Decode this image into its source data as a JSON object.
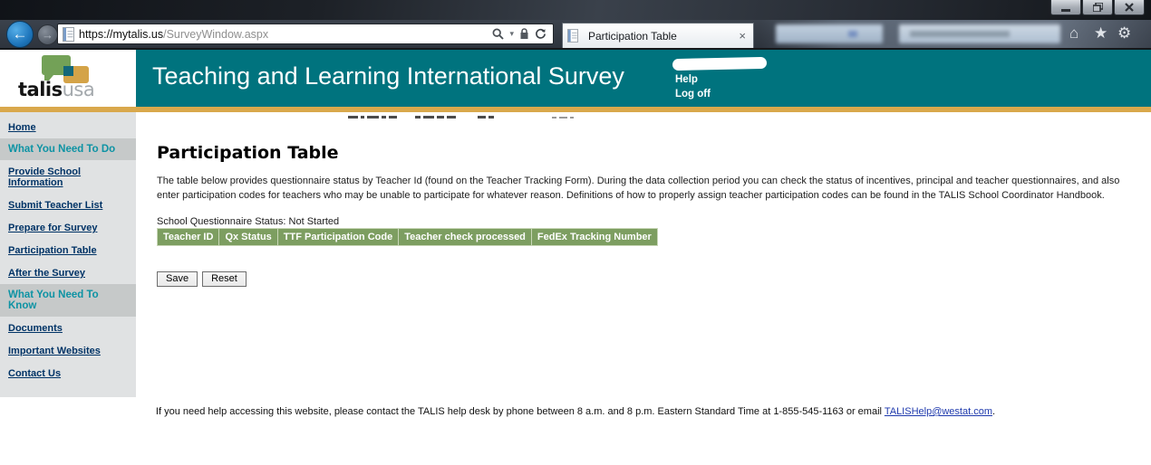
{
  "browser": {
    "url": {
      "host": "https://mytalis.us",
      "path": "/SurveyWindow.aspx"
    },
    "tab_title": "Participation Table",
    "tab_close": "×",
    "back_glyph": "←",
    "forward_glyph": "→",
    "caret_glyph": "▾",
    "home_glyph": "⌂",
    "star_glyph": "★",
    "gear_glyph": "⚙"
  },
  "header": {
    "logo_bold": "talis",
    "logo_light": "usa",
    "title": "Teaching and Learning International Survey",
    "help_label": "Help",
    "logoff_label": "Log off"
  },
  "sidebar": {
    "items": [
      {
        "label": "Home",
        "type": "link"
      },
      {
        "label": "What You Need To Do",
        "type": "section"
      },
      {
        "label": "Provide School Information",
        "type": "link"
      },
      {
        "label": "Submit Teacher List",
        "type": "link"
      },
      {
        "label": "Prepare for Survey",
        "type": "link"
      },
      {
        "label": "Participation Table",
        "type": "link"
      },
      {
        "label": "After the Survey",
        "type": "link"
      },
      {
        "label": "What You Need To Know",
        "type": "section"
      },
      {
        "label": "Documents",
        "type": "link"
      },
      {
        "label": "Important Websites",
        "type": "link"
      },
      {
        "label": "Contact Us",
        "type": "link"
      }
    ]
  },
  "main": {
    "title": "Participation Table",
    "description": "The table below provides questionnaire status by Teacher Id (found on the Teacher Tracking Form). During the data collection period you can check the status of incentives, principal and teacher questionnaires, and also enter participation codes for teachers who may be unable to participate for whatever reason. Definitions of how to properly assign teacher participation codes can be found in the TALIS School Coordinator Handbook.",
    "status_line": "School Questionnaire Status: Not Started",
    "table": {
      "columns": [
        "Teacher ID",
        "Qx Status",
        "TTF Participation Code",
        "Teacher check processed",
        "FedEx Tracking Number"
      ],
      "rows": []
    },
    "save_label": "Save",
    "reset_label": "Reset"
  },
  "footer": {
    "text": "If you need help accessing this website, please contact the TALIS help desk by phone between 8 a.m. and 8 p.m. Eastern Standard Time at 1-855-545-1163 or email ",
    "link": "TALISHelp@westat.com",
    "suffix": "."
  },
  "colors": {
    "header_teal": "#00737e",
    "gold_bar": "#d9a84c",
    "table_header_green": "#7d9e61",
    "sidebar_link_navy": "#003366",
    "sidebar_section_teal": "#0d93a4"
  }
}
